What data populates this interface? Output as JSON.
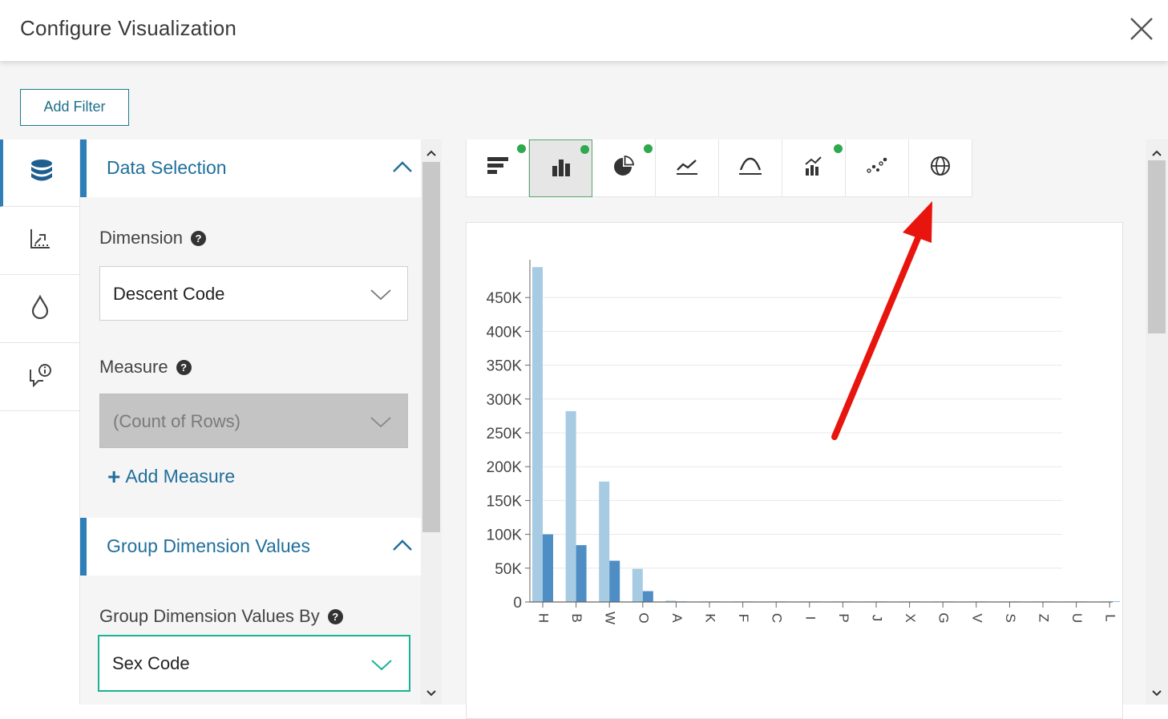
{
  "dialog": {
    "title": "Configure Visualization",
    "close_icon": "close-icon"
  },
  "toolbar": {
    "add_filter_label": "Add Filter"
  },
  "rail": {
    "items": [
      {
        "icon": "database-icon",
        "active": true
      },
      {
        "icon": "axes-chart-icon",
        "active": false
      },
      {
        "icon": "droplet-icon",
        "active": false
      },
      {
        "icon": "info-chat-icon",
        "active": false
      }
    ]
  },
  "panel": {
    "data_selection": {
      "header": "Data Selection",
      "dimension_label": "Dimension",
      "dimension_value": "Descent Code",
      "measure_label": "Measure",
      "measure_value": "(Count of Rows)",
      "add_measure_label": "Add Measure"
    },
    "group_dimension": {
      "header": "Group Dimension Values",
      "group_by_label": "Group Dimension Values By",
      "group_by_value": "Sex Code"
    }
  },
  "chart_types": [
    {
      "icon": "horizontal-bar-icon",
      "dot": true,
      "selected": false
    },
    {
      "icon": "column-bar-icon",
      "dot": true,
      "selected": true
    },
    {
      "icon": "pie-icon",
      "dot": true,
      "selected": false
    },
    {
      "icon": "line-icon",
      "dot": false,
      "selected": false
    },
    {
      "icon": "area-curve-icon",
      "dot": false,
      "selected": false
    },
    {
      "icon": "combo-chart-icon",
      "dot": true,
      "selected": false
    },
    {
      "icon": "scatter-icon",
      "dot": false,
      "selected": false
    },
    {
      "icon": "globe-map-icon",
      "dot": false,
      "selected": false
    }
  ],
  "colors": {
    "accent": "#2e7fb8",
    "series_light": "#a6cbe2",
    "series_dark": "#4e8ec4",
    "selected_border": "#57a86a",
    "dot": "#2fa84f",
    "annotation_arrow": "#e8150f"
  },
  "chart_data": {
    "type": "bar",
    "categories": [
      "H",
      "B",
      "W",
      "O",
      "A",
      "K",
      "F",
      "C",
      "I",
      "P",
      "J",
      "X",
      "G",
      "V",
      "S",
      "Z",
      "U",
      "L"
    ],
    "series": [
      {
        "values": [
          495000,
          282000,
          178000,
          49000,
          2000,
          500,
          300,
          200,
          150,
          120,
          100,
          80,
          60,
          40,
          30,
          20,
          10,
          5
        ]
      },
      {
        "values": [
          100000,
          84000,
          61000,
          16000,
          800,
          200,
          100,
          80,
          60,
          50,
          40,
          30,
          20,
          15,
          10,
          8,
          5,
          2
        ]
      }
    ],
    "yticks": [
      "0",
      "50K",
      "100K",
      "150K",
      "200K",
      "250K",
      "300K",
      "350K",
      "400K",
      "450K"
    ],
    "ylim": [
      0,
      500000
    ],
    "grid": true
  }
}
